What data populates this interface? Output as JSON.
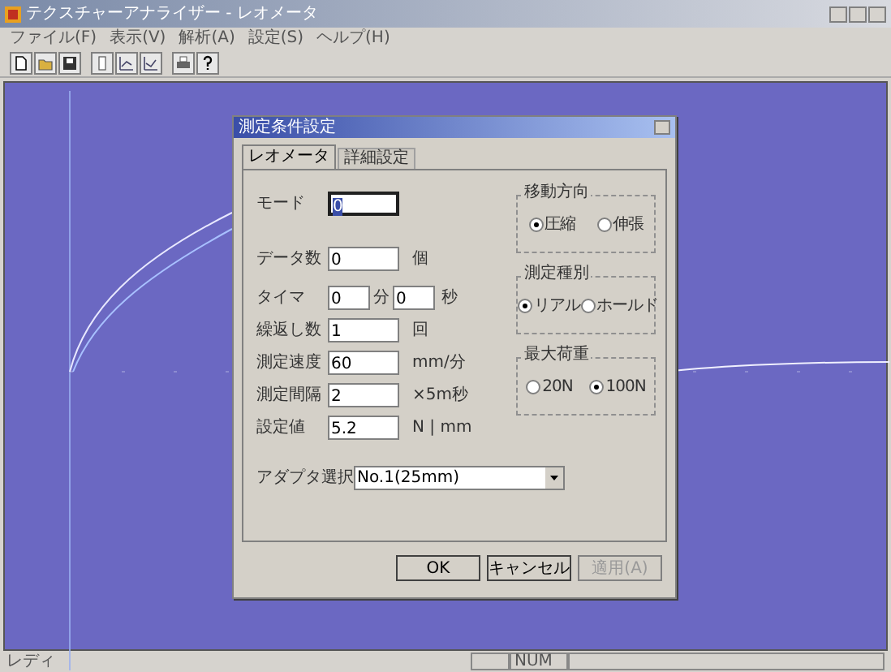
{
  "window": {
    "title": "テクスチャーアナライザー - レオメータ"
  },
  "menu": [
    "ファイル(F)",
    "表示(V)",
    "解析(A)",
    "設定(S)",
    "ヘルプ(H)"
  ],
  "dialog": {
    "title": "測定条件設定",
    "tabs": [
      {
        "label": "レオメータ",
        "selected": true
      },
      {
        "label": "詳細設定",
        "selected": false
      }
    ],
    "fields": [
      {
        "kind": "single",
        "label": "モード",
        "values": [
          "0"
        ],
        "selected": true
      },
      {
        "kind": "single",
        "label": "データ数",
        "values": [
          "0"
        ],
        "units": [
          "個"
        ],
        "selected": false
      },
      {
        "kind": "pair",
        "label": "タイマ",
        "values": [
          "0",
          "0"
        ],
        "units": [
          "分",
          "秒"
        ],
        "selected": false
      },
      {
        "kind": "single",
        "label": "繰返し数",
        "values": [
          "1"
        ],
        "units": [
          "回"
        ],
        "selected": false
      },
      {
        "kind": "single",
        "label": "測定速度",
        "values": [
          "60"
        ],
        "units": [
          "mm/分"
        ],
        "selected": false
      },
      {
        "kind": "single",
        "label": "測定間隔",
        "values": [
          "2"
        ],
        "units": [
          "×5m秒"
        ],
        "selected": false
      },
      {
        "kind": "single",
        "label": "設定値",
        "values": [
          "5.2"
        ],
        "units": [
          "N | mm"
        ],
        "selected": false
      }
    ],
    "groups": [
      {
        "title": "移動方向",
        "options": [
          {
            "label": "圧縮",
            "selected": true
          },
          {
            "label": "伸張",
            "selected": false
          }
        ]
      },
      {
        "title": "測定種別",
        "options": [
          {
            "label": "リアル",
            "selected": true
          },
          {
            "label": "ホールド",
            "selected": false
          }
        ]
      },
      {
        "title": "最大荷重",
        "options": [
          {
            "label": "20N",
            "selected": false
          },
          {
            "label": "100N",
            "selected": true
          }
        ]
      }
    ],
    "adapter": {
      "label": "アダプタ選択",
      "value": "No.1(25mm)"
    },
    "buttons": [
      {
        "label": "OK",
        "disabled": false
      },
      {
        "label": "キャンセル",
        "disabled": false
      },
      {
        "label": "適用(A)",
        "disabled": true
      }
    ]
  },
  "status_bar": {
    "text": "レディ",
    "indicator": "NUM"
  }
}
